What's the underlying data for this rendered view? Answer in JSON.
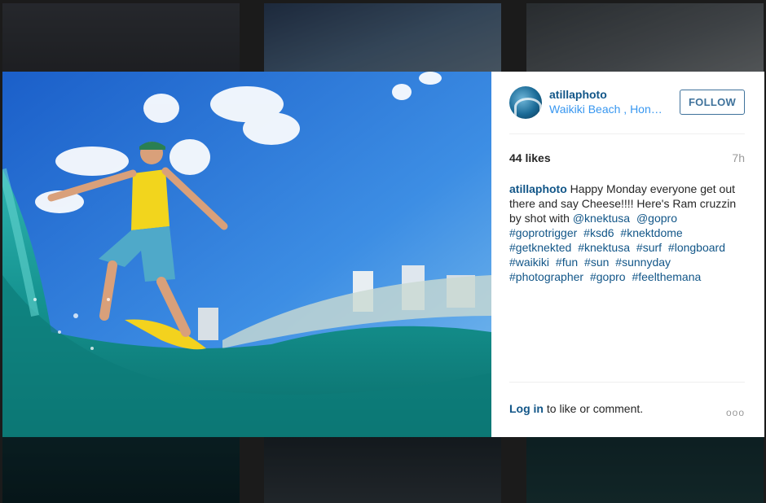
{
  "post": {
    "username": "atillaphoto",
    "location": "Waikiki Beach , Hon…",
    "follow_label": "FOLLOW",
    "likes": "44 likes",
    "time": "7h",
    "caption_author": "atillaphoto",
    "caption_text": "Happy Monday everyone get out there and say Cheese!!!! Here's Ram cruzzin by shot with",
    "caption_tags": [
      "@knektusa",
      "@gopro",
      "#goprotrigger",
      "#ksd6",
      "#knektdome",
      "#getknekted",
      "#knektusa",
      "#surf",
      "#longboard",
      "#waikiki",
      "#fun",
      "#sun",
      "#sunnyday",
      "#photographer",
      "#gopro",
      "#feelthemana"
    ],
    "login_link": "Log in",
    "login_suffix": "to like or comment.",
    "more_label": "ooo"
  },
  "colors": {
    "link": "#125688",
    "location": "#3897f0",
    "follow_border": "#3f729b"
  },
  "icons": {
    "avatar": "avatar-wave-photo",
    "more": "more-options-icon"
  }
}
